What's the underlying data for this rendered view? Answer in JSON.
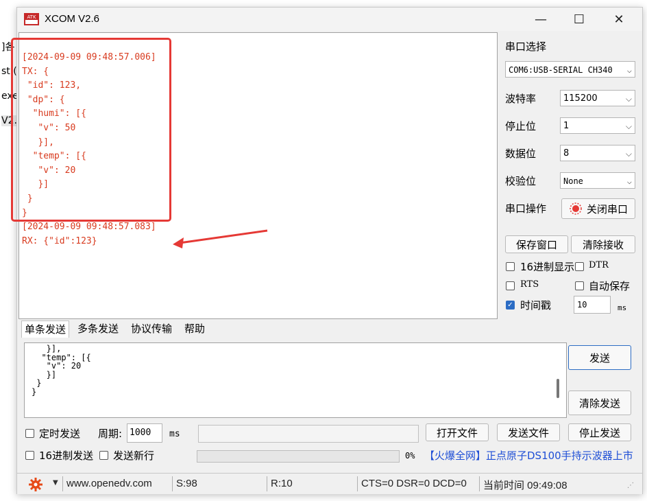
{
  "background_fragments": [
    "]各",
    "st.(",
    "exe",
    "V2."
  ],
  "window": {
    "title": "XCOM V2.6",
    "logo_text": "ATK",
    "minimize_glyph": "—",
    "maximize_glyph": "☐",
    "close_glyph": "✕"
  },
  "receive": {
    "lines": [
      "[2024-09-09 09:48:57.006]",
      "TX: {",
      " \"id\": 123,",
      " \"dp\": {",
      "  \"humi\": [{",
      "   \"v\": 50",
      "   }],",
      "  \"temp\": [{",
      "   \"v\": 20",
      "   }]",
      " }",
      "}",
      "[2024-09-09 09:48:57.083]",
      "RX: {\"id\":123}"
    ]
  },
  "serial": {
    "port_label": "串口选择",
    "port_value": "COM6:USB-SERIAL CH340",
    "baud_label": "波特率",
    "baud_value": "115200",
    "stop_label": "停止位",
    "stop_value": "1",
    "data_label": "数据位",
    "data_value": "8",
    "parity_label": "校验位",
    "parity_value": "None",
    "op_label": "串口操作",
    "close_port_label": "关闭串口",
    "save_window_label": "保存窗口",
    "clear_recv_label": "清除接收",
    "hex_display_label": "16进制显示",
    "dtr_label": "DTR",
    "rts_label": "RTS",
    "auto_save_label": "自动保存",
    "timestamp_label": "时间戳",
    "timestamp_value": "10",
    "timestamp_unit": "ms"
  },
  "tabs": [
    "单条发送",
    "多条发送",
    "协议传输",
    "帮助"
  ],
  "send": {
    "lines": [
      "   }],",
      "  \"temp\": [{",
      "   \"v\": 20",
      "   }]",
      " }",
      "}"
    ],
    "send_label": "发送",
    "clear_send_label": "清除发送"
  },
  "bottom": {
    "timed_send_label": "定时发送",
    "period_label": "周期:",
    "period_value": "1000",
    "period_unit": "ms",
    "open_file_label": "打开文件",
    "send_file_label": "发送文件",
    "stop_send_label": "停止发送",
    "hex_send_label": "16进制发送",
    "send_newline_label": "发送新行",
    "progress_text": "0%",
    "progress": 0,
    "ad_text": "【火爆全网】正点原子DS100手持示波器上市"
  },
  "statusbar": {
    "url": "www.openedv.com",
    "sent": "S:98",
    "received": "R:10",
    "signals": "CTS=0 DSR=0 DCD=0",
    "time": "当前时间 09:49:08"
  },
  "colors": {
    "rx_text": "#d83a1e",
    "highlight": "#e53935",
    "checkbox_on": "#2b6cc4",
    "ad_text": "#1f4fd6"
  }
}
